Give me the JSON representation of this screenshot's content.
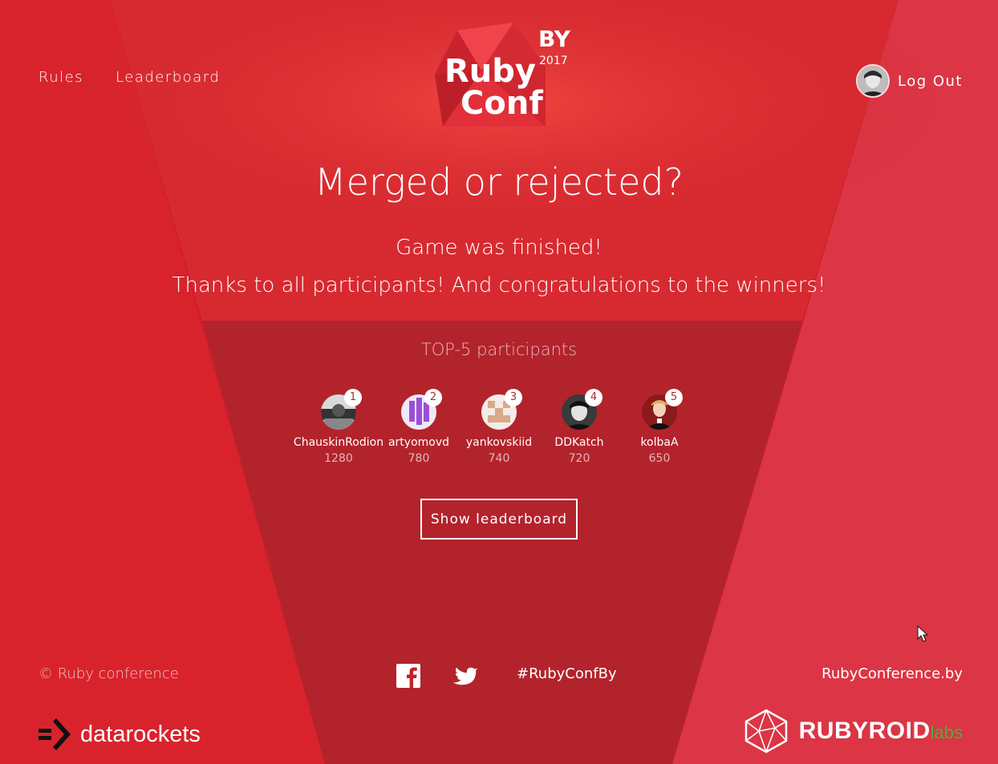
{
  "nav": {
    "rules": "Rules",
    "leaderboard": "Leaderboard",
    "logout": "Log Out"
  },
  "logo": {
    "line1": "Ruby",
    "line2": "Conf",
    "country": "BY",
    "year": "2017"
  },
  "hero": {
    "headline": "Merged or rejected?",
    "status": "Game was finished!",
    "thanks": "Thanks to all participants! And congratulations to the winners!"
  },
  "top": {
    "title": "TOP-5 participants",
    "participants": [
      {
        "rank": "1",
        "name": "ChauskinRodion",
        "score": "1280"
      },
      {
        "rank": "2",
        "name": "artyomovd",
        "score": "780"
      },
      {
        "rank": "3",
        "name": "yankovskiid",
        "score": "740"
      },
      {
        "rank": "4",
        "name": "DDKatch",
        "score": "720"
      },
      {
        "rank": "5",
        "name": "kolbaA",
        "score": "650"
      }
    ],
    "button": "Show leaderboard"
  },
  "footer": {
    "copyright": "© Ruby conference",
    "hashtag": "#RubyConfBy",
    "site": "RubyConference.by",
    "sponsor1": "datarockets",
    "sponsor2": "RUBYROID",
    "sponsor2_suffix": "labs"
  },
  "colors": {
    "background": "#c81f2b",
    "accent_green": "#4caf3c",
    "badge_text": "#b52630"
  },
  "icons": [
    "facebook-icon",
    "twitter-icon",
    "datarockets-logo-icon",
    "rubyroid-logo-icon",
    "cursor-icon"
  ]
}
